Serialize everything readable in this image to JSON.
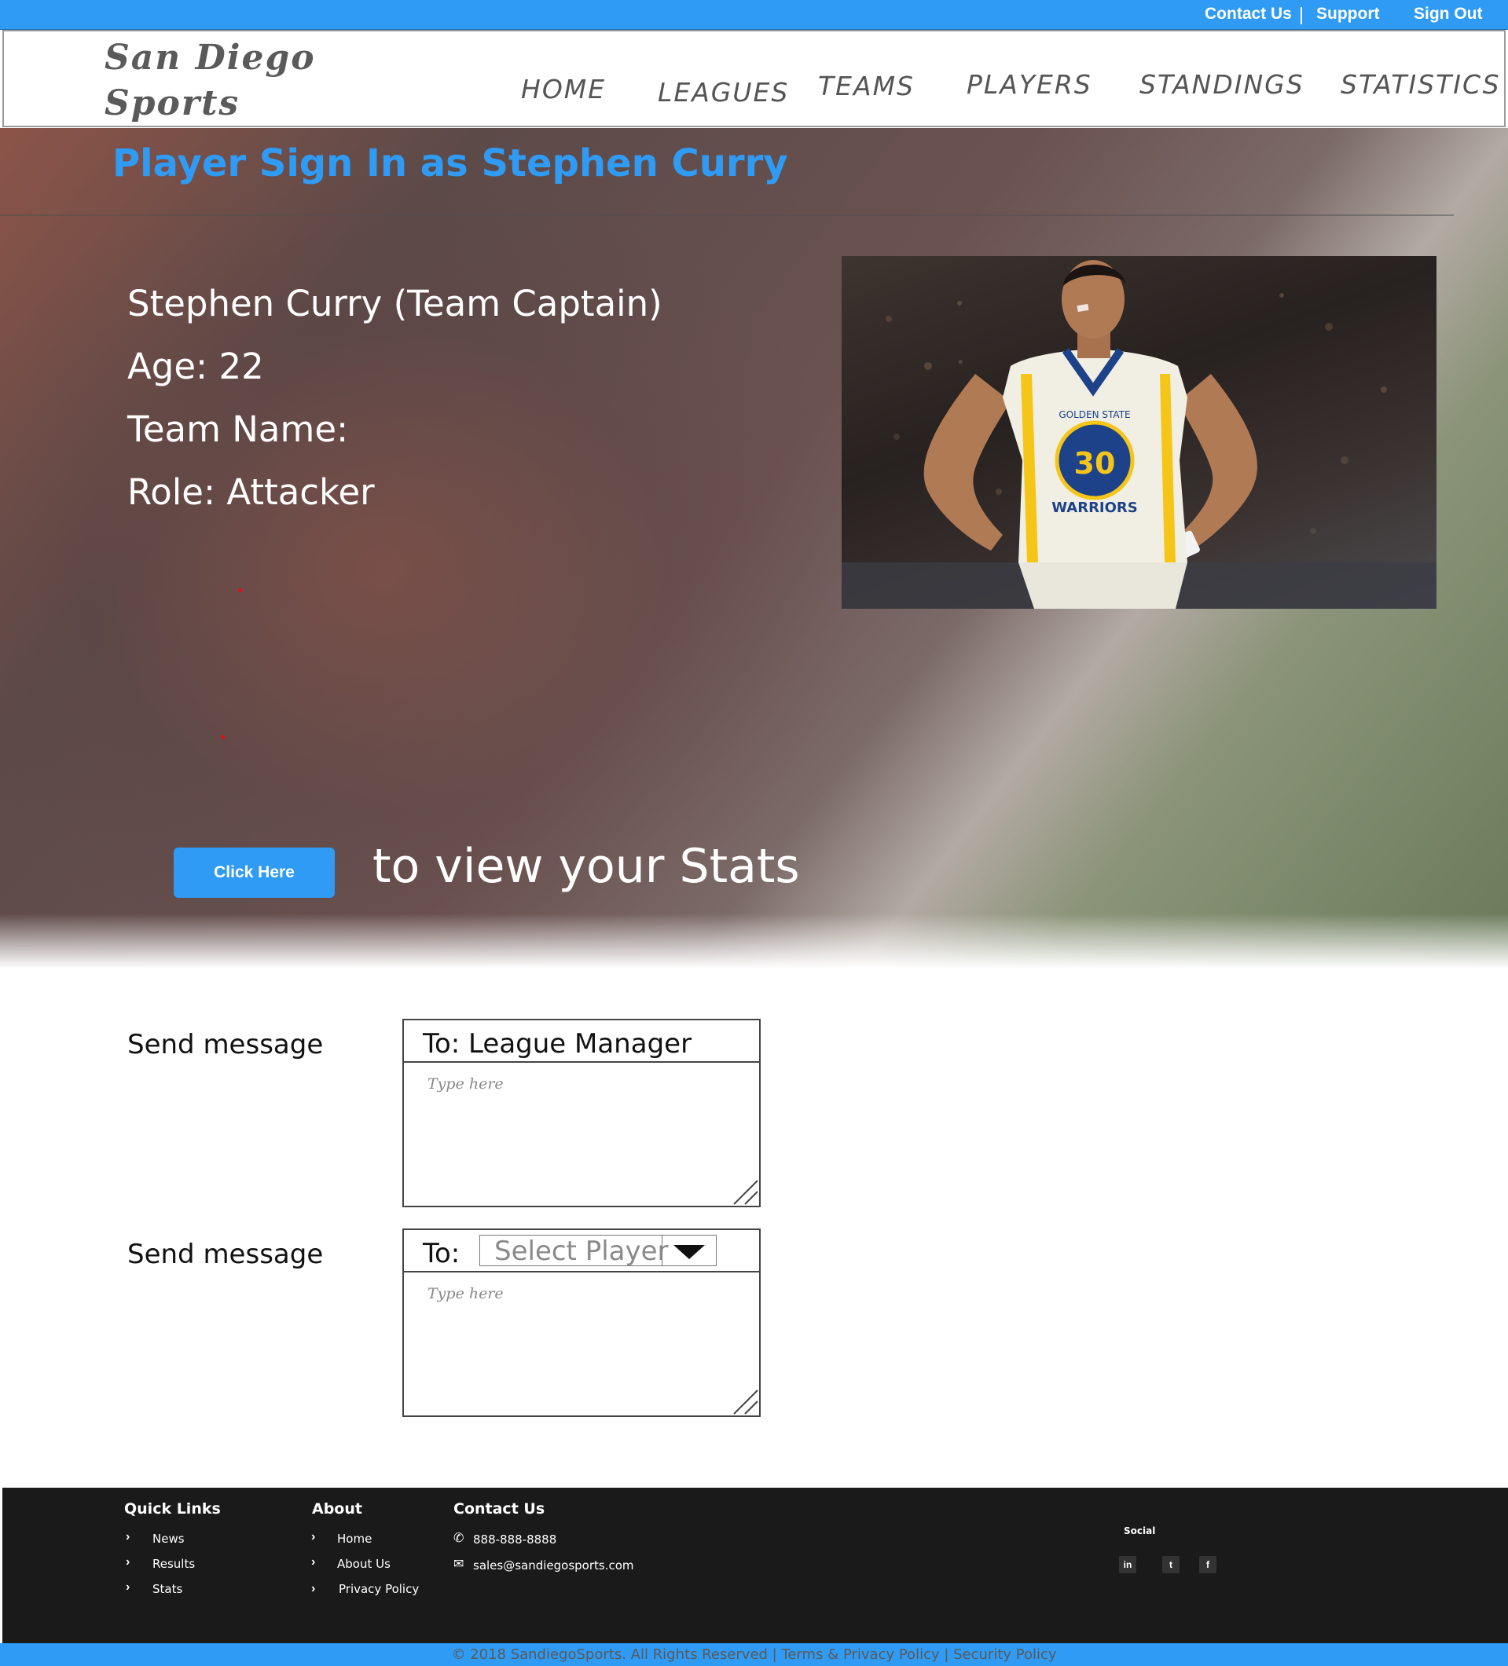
{
  "topbar": {
    "contact": "Contact Us",
    "support": "Support",
    "signout": "Sign Out"
  },
  "header": {
    "logo_line1": "San Diego",
    "logo_line2": "Sports",
    "nav": [
      "HOME",
      "LEAGUES",
      "TEAMS",
      "PLAYERS",
      "STANDINGS",
      "STATISTICS"
    ]
  },
  "hero": {
    "title": "Player Sign In as Stephen Curry",
    "player_name": "Stephen Curry (Team Captain)",
    "age": "Age: 22",
    "team_name": "Team Name:",
    "role": "Role: Attacker",
    "jersey_number": "30",
    "jersey_text": "GOLDEN STATE",
    "jersey_team": "WARRIORS",
    "stats_button": "Click Here",
    "stats_text": "to view your Stats"
  },
  "messages": [
    {
      "label": "Send message",
      "to_label": "To: League Manager",
      "placeholder": "Type here"
    },
    {
      "label": "Send message",
      "to_label": "To:",
      "select_value": "Select Player",
      "placeholder": "Type here"
    }
  ],
  "footer": {
    "quick_links": {
      "heading": "Quick Links",
      "items": [
        "News",
        "Results",
        "Stats"
      ]
    },
    "about": {
      "heading": "About",
      "items": [
        "Home",
        "About Us",
        "Privacy Policy"
      ]
    },
    "contact": {
      "heading": "Contact Us",
      "phone": "888-888-8888",
      "email": "sales@sandiegosports.com"
    },
    "social": {
      "heading": "Social",
      "icons": [
        "in",
        "t",
        "f"
      ]
    },
    "copyright": "© 2018 SandiegoSports. All Rights Reserved | Terms & Privacy Policy | Security Policy"
  },
  "colors": {
    "accent": "#2f9bf5",
    "footer_bg": "#1a1a1a"
  }
}
